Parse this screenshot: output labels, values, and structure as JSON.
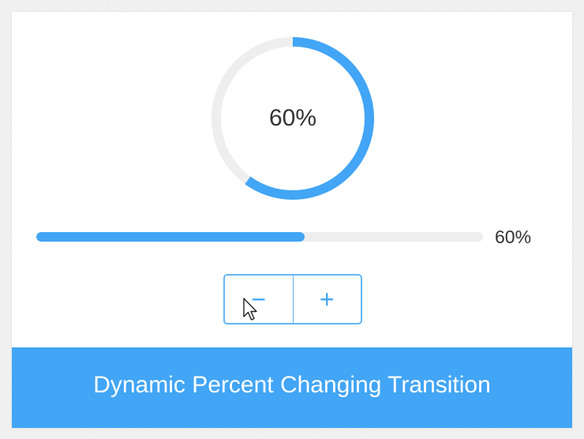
{
  "ring": {
    "percent": 60,
    "label": "60%"
  },
  "progress_bar": {
    "percent": 60,
    "label": "60%"
  },
  "controls": {
    "decrement_label": "−",
    "increment_label": "+"
  },
  "footer": {
    "title": "Dynamic Percent Changing Transition"
  },
  "colors": {
    "accent": "#42a5f5",
    "track": "#eeeeee",
    "text": "#333333"
  }
}
